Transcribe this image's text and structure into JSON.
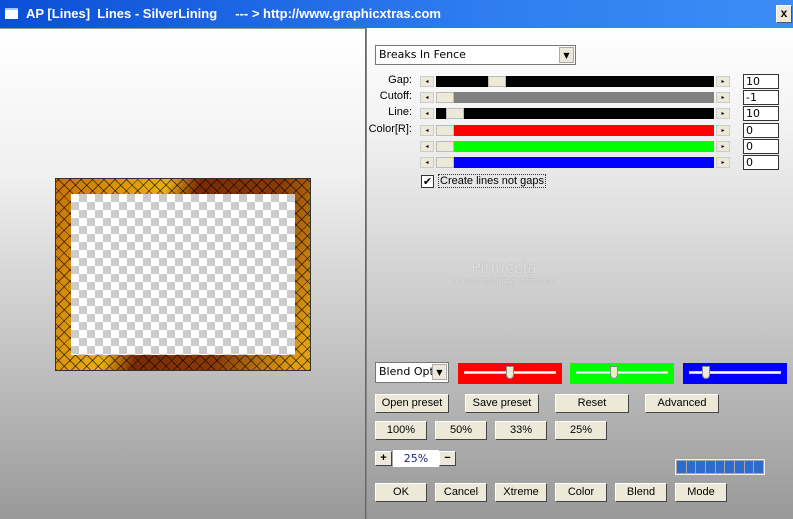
{
  "window": {
    "title": "AP [Lines]  Lines - SilverLining     --- > http://www.graphicxtras.com",
    "close_label": "x"
  },
  "preset": {
    "selected": "Breaks In Fence"
  },
  "sliders": [
    {
      "label": "Gap:",
      "value": "10",
      "track_color": "#000000",
      "position": 0.2
    },
    {
      "label": "Cutoff:",
      "value": "-1",
      "track_color": "#808080",
      "position": 0.0
    },
    {
      "label": "Line:",
      "value": "10",
      "track_color": "#000000",
      "position": 0.04
    },
    {
      "label": "Color[R]:",
      "value": "0",
      "track_color": "#ff0000",
      "position": 0.0
    },
    {
      "label": "",
      "value": "0",
      "track_color": "#00ff00",
      "position": 0.0
    },
    {
      "label": "",
      "value": "0",
      "track_color": "#0000ff",
      "position": 0.0
    }
  ],
  "checkbox": {
    "label": "Create lines not gaps",
    "checked": true
  },
  "watermark": {
    "name": "Pinuccia",
    "url": "www.maidiregrafica.eu"
  },
  "blend": {
    "selected": "Blend Optio",
    "color_sliders": [
      {
        "color": "#ff0000",
        "position": 0.5
      },
      {
        "color": "#00ff00",
        "position": 0.4
      },
      {
        "color": "#0000ff",
        "position": 0.15
      }
    ]
  },
  "buttons": {
    "open_preset": "Open preset",
    "save_preset": "Save preset",
    "reset": "Reset",
    "advanced": "Advanced",
    "zoom100": "100%",
    "zoom50": "50%",
    "zoom33": "33%",
    "zoom25": "25%",
    "plus": "+",
    "minus": "−",
    "ok": "OK",
    "cancel": "Cancel",
    "xtreme": "Xtreme",
    "color": "Color",
    "blend": "Blend",
    "mode": "Mode"
  },
  "zoom": {
    "value": "25%"
  },
  "progress": {
    "segments": 9
  }
}
